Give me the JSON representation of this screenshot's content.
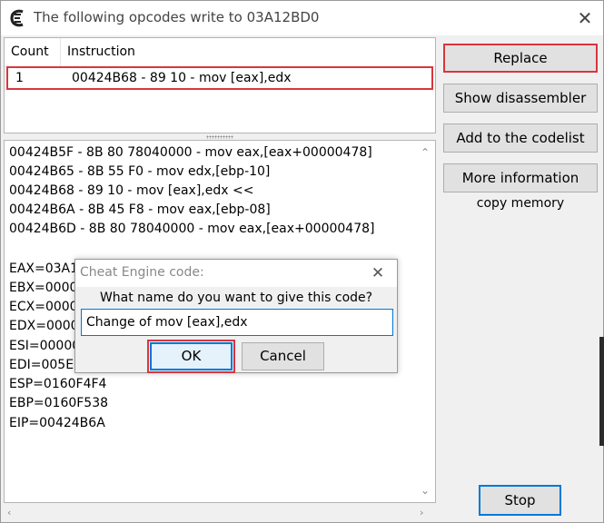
{
  "window": {
    "title": "The following opcodes write to 03A12BD0",
    "close_glyph": "✕",
    "app_icon": "cheat-engine-icon"
  },
  "opcode_list": {
    "columns": [
      "Count",
      "Instruction"
    ],
    "rows": [
      {
        "count": "1",
        "instruction": "00424B68 - 89 10  - mov [eax],edx"
      }
    ]
  },
  "disassembly": {
    "lines": [
      "00424B5F - 8B 80 78040000  - mov eax,[eax+00000478]",
      "00424B65 - 8B 55 F0  - mov edx,[ebp-10]",
      "00424B68 - 89 10  - mov [eax],edx <<",
      "00424B6A - 8B 45 F8  - mov eax,[ebp-08]",
      "00424B6D - 8B 80 78040000  - mov eax,[eax+00000478]"
    ],
    "registers": [
      "EAX=03A1",
      "EBX=0000",
      "ECX=0000",
      "EDX=0000",
      "ESI=00000",
      "EDI=005E0",
      "ESP=0160F4F4",
      "EBP=0160F538",
      "EIP=00424B6A"
    ]
  },
  "buttons": {
    "replace": "Replace",
    "show_disassembler": "Show disassembler",
    "add_to_codelist": "Add to the codelist",
    "more_information": "More information",
    "copy_memory": "copy memory",
    "stop": "Stop"
  },
  "dialog": {
    "title": "Cheat Engine code:",
    "close_glyph": "✕",
    "question": "What name do you want to give this code?",
    "input_value": "Change of mov [eax],edx",
    "ok": "OK",
    "cancel": "Cancel"
  },
  "colors": {
    "highlight_red": "#d9363e",
    "focus_blue": "#0078d7"
  }
}
